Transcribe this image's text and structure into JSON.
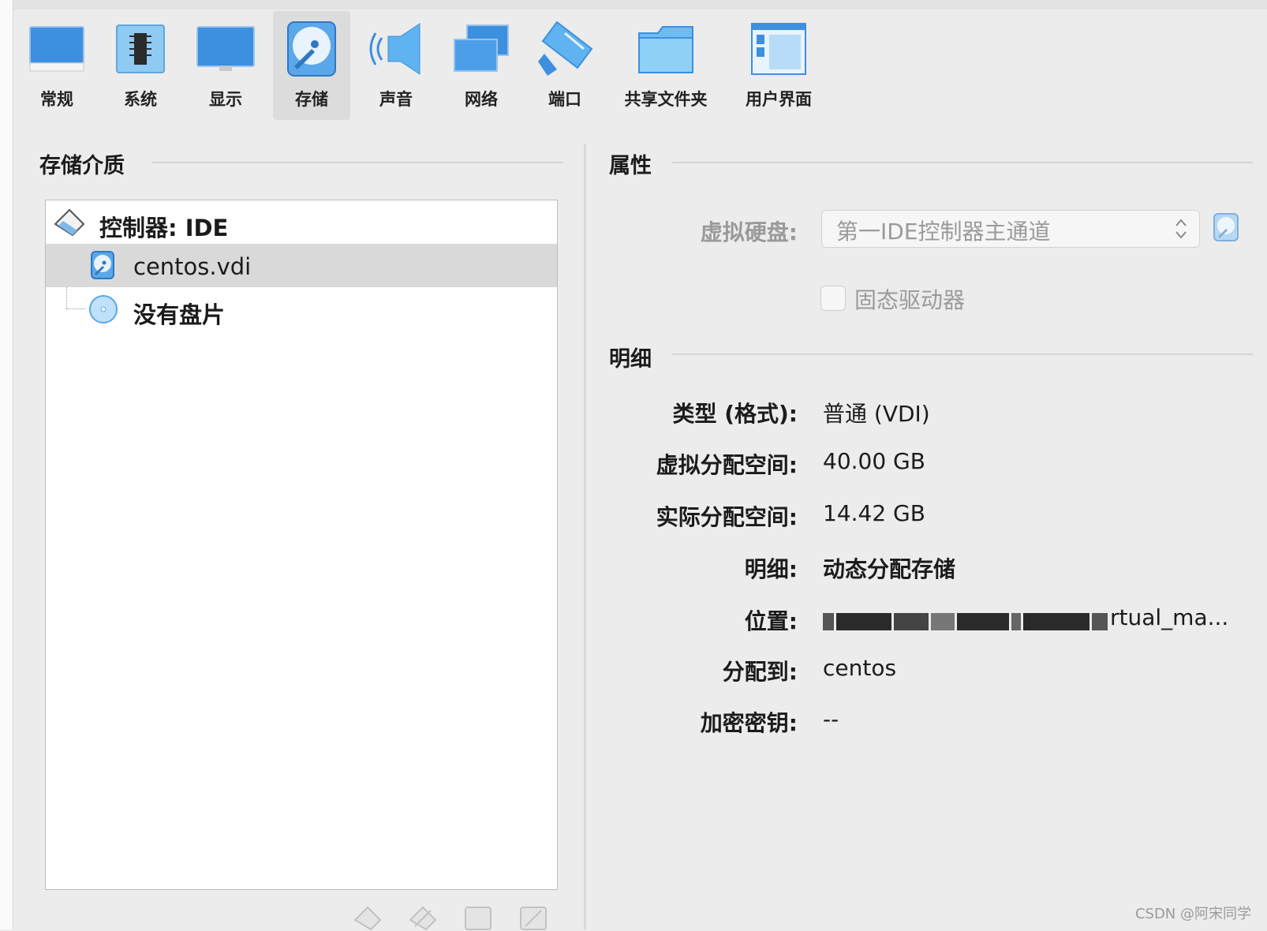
{
  "toolbar": {
    "items": [
      {
        "label": "常规",
        "icon": "general-monitor-icon"
      },
      {
        "label": "系统",
        "icon": "system-chip-icon"
      },
      {
        "label": "显示",
        "icon": "display-monitor-icon"
      },
      {
        "label": "存储",
        "icon": "storage-disk-icon"
      },
      {
        "label": "声音",
        "icon": "audio-speaker-icon"
      },
      {
        "label": "网络",
        "icon": "network-icon"
      },
      {
        "label": "端口",
        "icon": "ports-plug-icon"
      },
      {
        "label": "共享文件夹",
        "icon": "shared-folder-icon"
      },
      {
        "label": "用户界面",
        "icon": "user-interface-icon"
      }
    ],
    "active": "存储"
  },
  "storage": {
    "title": "存储介质",
    "tree": {
      "controller": "控制器: IDE",
      "items": [
        {
          "label": "centos.vdi",
          "icon": "hard-disk-icon"
        },
        {
          "label": "没有盘片",
          "icon": "optical-disc-icon"
        }
      ]
    }
  },
  "attributes": {
    "title": "属性",
    "virtual_disk_label": "虚拟硬盘:",
    "virtual_disk_value": "第一IDE控制器主通道",
    "ssd_label": "固态驱动器"
  },
  "details": {
    "title": "明细",
    "rows": [
      {
        "label": "类型 (格式):",
        "value": "普通 (VDI)"
      },
      {
        "label": "虚拟分配空间:",
        "value": "40.00 GB"
      },
      {
        "label": "实际分配空间:",
        "value": "14.42 GB"
      },
      {
        "label": "明细:",
        "value": "动态分配存储"
      },
      {
        "label": "位置:",
        "value": "rtual_ma..."
      },
      {
        "label": "分配到:",
        "value": "centos"
      },
      {
        "label": "加密密钥:",
        "value": "--"
      }
    ]
  },
  "watermark": "CSDN @阿宋同学"
}
